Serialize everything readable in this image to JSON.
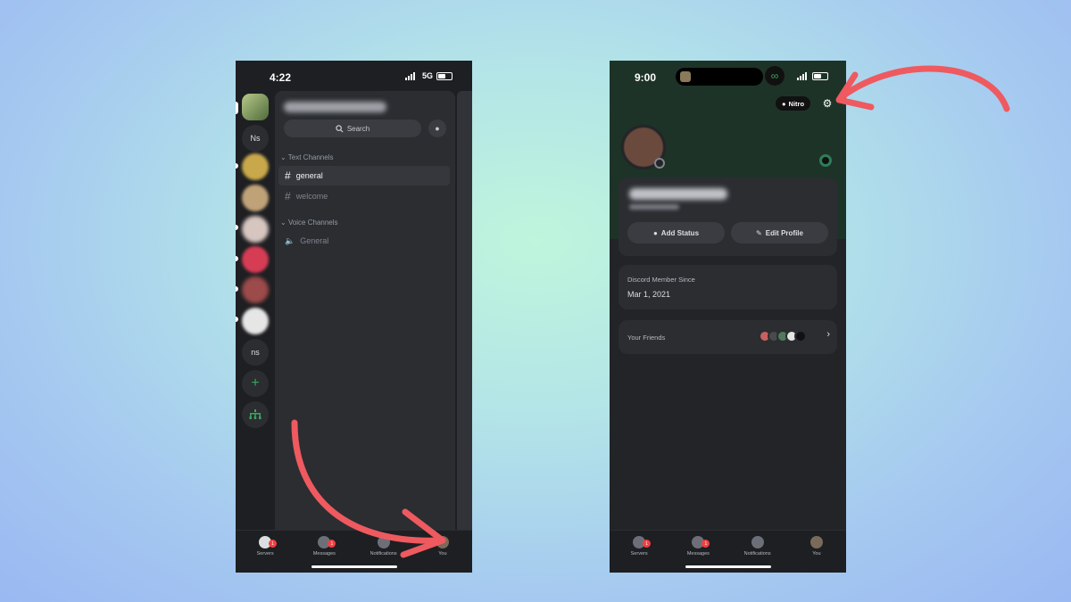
{
  "left_phone": {
    "status_time": "4:22",
    "network": "5G",
    "server_rail": {
      "labels": [
        "Ns",
        "ns"
      ],
      "add_icon": "plus-icon",
      "discover_icon": "hub-icon"
    },
    "search_label": "Search",
    "text_category": "Text Channels",
    "text_channels": [
      "general",
      "welcome"
    ],
    "voice_category": "Voice Channels",
    "voice_channels": [
      "General"
    ],
    "tabs": [
      {
        "label": "Servers",
        "badge": "1"
      },
      {
        "label": "Messages",
        "badge": "1"
      },
      {
        "label": "Notifications"
      },
      {
        "label": "You"
      }
    ]
  },
  "right_phone": {
    "status_time": "9:00",
    "nitro_label": "Nitro",
    "settings_icon": "gear-icon",
    "add_status_label": "Add Status",
    "edit_profile_label": "Edit Profile",
    "member_since_label": "Discord Member Since",
    "member_since_value": "Mar 1, 2021",
    "friends_label": "Your Friends",
    "tabs": [
      {
        "label": "Servers",
        "badge": "1"
      },
      {
        "label": "Messages",
        "badge": "1"
      },
      {
        "label": "Notifications"
      },
      {
        "label": "You"
      }
    ]
  },
  "colors": {
    "annotation_arrow": "#ee5a5f",
    "app_background": "#1e1f22",
    "profile_banner": "#1e3328",
    "online_status": "#3ba55c",
    "badge_red": "#f23f43"
  }
}
